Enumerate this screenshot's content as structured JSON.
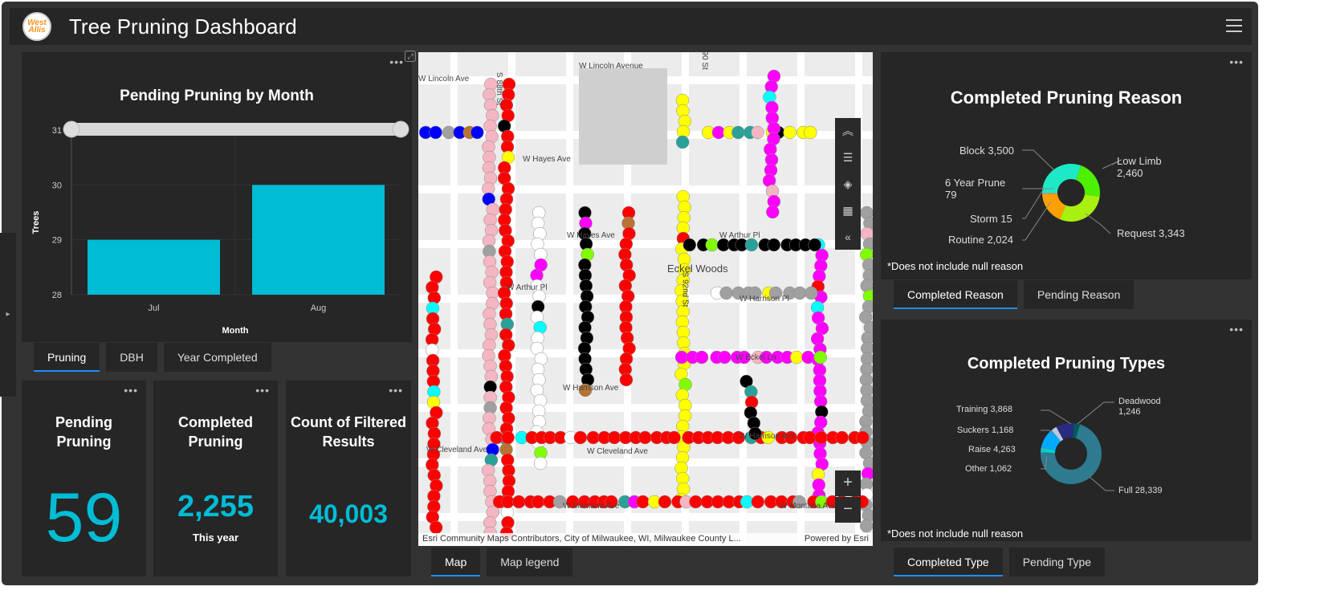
{
  "header": {
    "title": "Tree Pruning Dashboard",
    "logo_text": "West Allis"
  },
  "chart_panel": {
    "tabs": [
      "Pruning",
      "DBH",
      "Year Completed"
    ]
  },
  "chart_data": {
    "type": "bar",
    "title": "Pending Pruning by Month",
    "categories": [
      "Jul",
      "Aug"
    ],
    "values": [
      29,
      30
    ],
    "xlabel": "Month",
    "ylabel": "Trees",
    "ylim": [
      28,
      31
    ],
    "yticks": [
      28,
      29,
      30,
      31
    ],
    "color": "#00bcd4"
  },
  "kpis": [
    {
      "label": "Pending Pruning",
      "value": "59"
    },
    {
      "label": "Completed Pruning",
      "value": "2,255",
      "sub": "This year"
    },
    {
      "label": "Count of Filtered Results",
      "value": "40,003"
    }
  ],
  "map": {
    "attribution": "Esri Community Maps Contributors, City of Milwaukee, WI, Milwaukee County L...",
    "powered": "Powered by Esri",
    "tabs": [
      "Map",
      "Map legend"
    ],
    "streets": [
      "W Lincoln Avenue",
      "W Lincoln Ave",
      "W Hayes Ave",
      "W Hayes Ave",
      "W Arthur Pl",
      "W Arthur Pl",
      "W Harrison Pl",
      "W Eckel Ln",
      "W Harrison Ave",
      "W Harrison Ave",
      "W Cleveland Ave",
      "W Cleveland Ave",
      "W Montana Ave",
      "W Montana Ave",
      "Eckel Woods",
      "S 90 St",
      "S 88th St",
      "S 92nd St"
    ]
  },
  "reason": {
    "title": "Completed Pruning Reason",
    "note": "*Does not include null reason",
    "tabs": [
      "Completed Reason",
      "Pending Reason"
    ],
    "slices": [
      {
        "label": "Low Limb",
        "value": "2,460",
        "n": 2460,
        "color": "#4cf000"
      },
      {
        "label": "Request",
        "value": "3,343",
        "n": 3343,
        "color": "#a8f00f"
      },
      {
        "label": "Routine",
        "value": "2,024",
        "n": 2024,
        "color": "#ffa000"
      },
      {
        "label": "Storm",
        "value": "15",
        "n": 15,
        "color": "#88cc44"
      },
      {
        "label": "6 Year Prune",
        "value": "79",
        "n": 79,
        "color": "#b0b0b0"
      },
      {
        "label": "Block",
        "value": "3,500",
        "n": 3500,
        "color": "#1de9c6"
      }
    ]
  },
  "types": {
    "title": "Completed Pruning Types",
    "note": "*Does not include null reason",
    "tabs": [
      "Completed Type",
      "Pending Type"
    ],
    "slices": [
      {
        "label": "Deadwood",
        "value": "1,246",
        "n": 1246,
        "color": "#005a5a"
      },
      {
        "label": "Full",
        "value": "28,339",
        "n": 28339,
        "color": "#2e7a8e"
      },
      {
        "label": "Other",
        "value": "1,062",
        "n": 1062,
        "color": "#00d0d0"
      },
      {
        "label": "Raise",
        "value": "4,263",
        "n": 4263,
        "color": "#00aaff"
      },
      {
        "label": "Suckers",
        "value": "1,168",
        "n": 1168,
        "color": "#c0c8d8"
      },
      {
        "label": "Training",
        "value": "3,868",
        "n": 3868,
        "color": "#2a2a80"
      }
    ]
  }
}
